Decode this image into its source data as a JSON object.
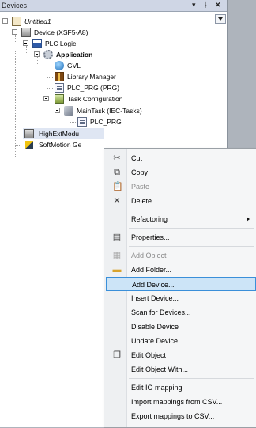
{
  "panel": {
    "title": "Devices"
  },
  "tree": {
    "project": "Untitled1",
    "device": "Device (XSF5-A8)",
    "plc_logic": "PLC Logic",
    "application": "Application",
    "gvl": "GVL",
    "library_manager": "Library Manager",
    "plc_prg": "PLC_PRG (PRG)",
    "task_configuration": "Task Configuration",
    "main_task": "MainTask (IEC-Tasks)",
    "plc_prg_call": "PLC_PRG",
    "high_ext": "HighExtModu",
    "softmotion": "SoftMotion Ge"
  },
  "menu": {
    "cut": "Cut",
    "copy": "Copy",
    "paste": "Paste",
    "delete": "Delete",
    "refactoring": "Refactoring",
    "properties": "Properties...",
    "add_object": "Add Object",
    "add_folder": "Add Folder...",
    "add_device": "Add Device...",
    "insert_device": "Insert Device...",
    "scan_devices": "Scan for Devices...",
    "disable_device": "Disable Device",
    "update_device": "Update Device...",
    "edit_object": "Edit Object",
    "edit_object_with": "Edit Object With...",
    "edit_io_mapping": "Edit IO mapping",
    "import_mappings": "Import mappings from CSV...",
    "export_mappings": "Export mappings to CSV..."
  },
  "colors": {
    "selection": "#cce4f7",
    "selection_border": "#3a8fd9",
    "title_bg": "#cfd6e5"
  }
}
